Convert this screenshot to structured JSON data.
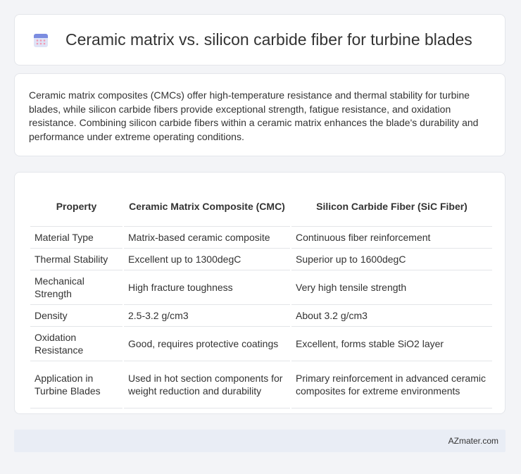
{
  "header": {
    "title": "Ceramic matrix vs. silicon carbide fiber for turbine blades",
    "icon": "calendar-icon"
  },
  "intro": {
    "text": "Ceramic matrix composites (CMCs) offer high-temperature resistance and thermal stability for turbine blades, while silicon carbide fibers provide exceptional strength, fatigue resistance, and oxidation resistance. Combining silicon carbide fibers within a ceramic matrix enhances the blade's durability and performance under extreme operating conditions."
  },
  "table": {
    "headers": [
      "Property",
      "Ceramic Matrix Composite (CMC)",
      "Silicon Carbide Fiber (SiC Fiber)"
    ],
    "rows": [
      [
        "Material Type",
        "Matrix-based ceramic composite",
        "Continuous fiber reinforcement"
      ],
      [
        "Thermal Stability",
        "Excellent up to 1300degC",
        "Superior up to 1600degC"
      ],
      [
        "Mechanical Strength",
        "High fracture toughness",
        "Very high tensile strength"
      ],
      [
        "Density",
        "2.5-3.2 g/cm3",
        "About 3.2 g/cm3"
      ],
      [
        "Oxidation Resistance",
        "Good, requires protective coatings",
        "Excellent, forms stable SiO2 layer"
      ],
      [
        "Application in Turbine Blades",
        "Used in hot section components for weight reduction and durability",
        "Primary reinforcement in advanced ceramic composites for extreme environments"
      ]
    ]
  },
  "footer": {
    "brand": "AZmater.com"
  }
}
